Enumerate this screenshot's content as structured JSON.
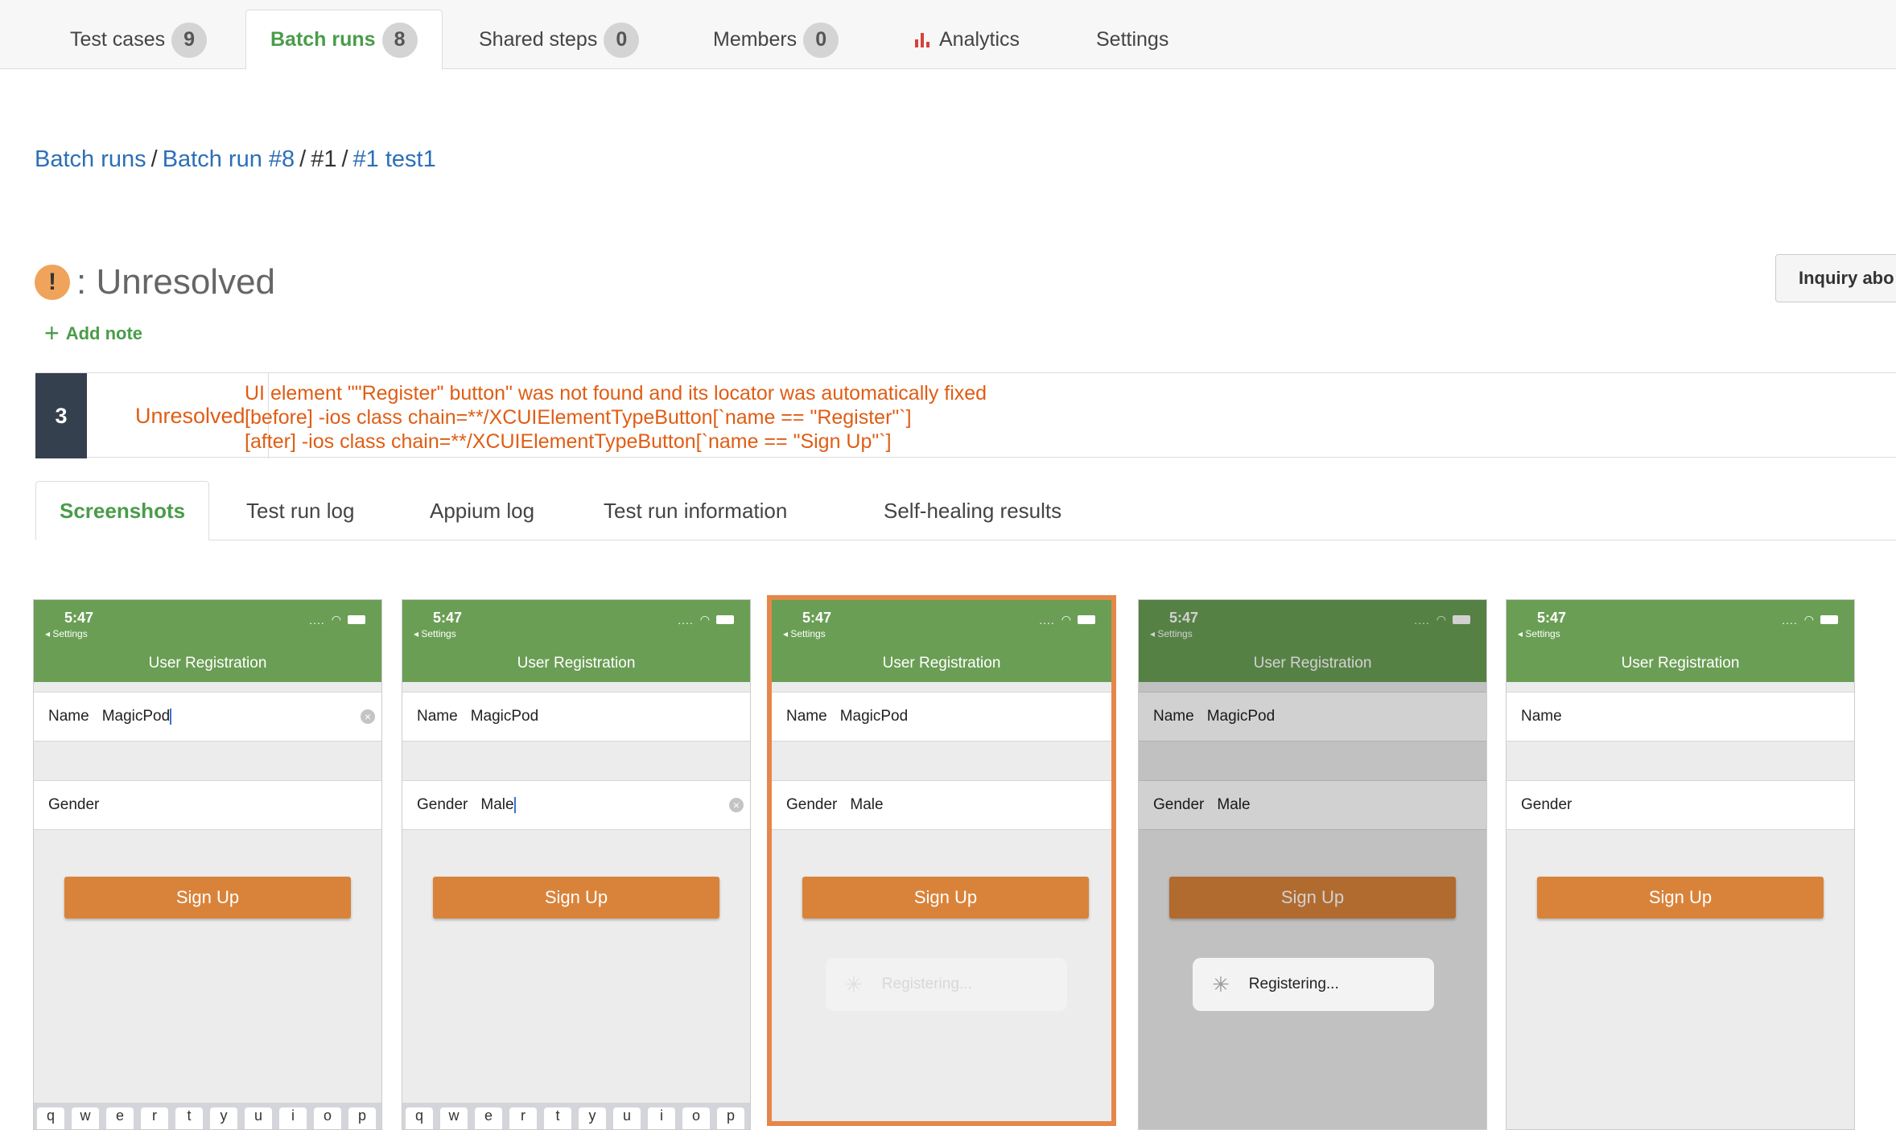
{
  "top_tabs": [
    {
      "label": "Test cases",
      "count": "9"
    },
    {
      "label": "Batch runs",
      "count": "8"
    },
    {
      "label": "Shared steps",
      "count": "0"
    },
    {
      "label": "Members",
      "count": "0"
    },
    {
      "label": "Analytics"
    },
    {
      "label": "Settings"
    }
  ],
  "breadcrumb": {
    "batch_runs": "Batch runs",
    "batch_run": "Batch run #8",
    "run": "#1",
    "test": "#1 test1",
    "separator": "/"
  },
  "status": {
    "icon": "!",
    "text": ": Unresolved",
    "add_note": "Add note",
    "inquiry_button": "Inquiry abo"
  },
  "result": {
    "step": "3",
    "status": "Unresolved",
    "messages": [
      "UI element \"\"Register\" button\" was not found and its locator was automatically fixed",
      "[before] -ios class chain=**/XCUIElementTypeButton[`name == \"Register\"`]",
      "[after] -ios class chain=**/XCUIElementTypeButton[`name == \"Sign Up\"`]"
    ]
  },
  "sub_tabs": [
    "Screenshots",
    "Test run log",
    "Appium log",
    "Test run information",
    "Self-healing results"
  ],
  "phone": {
    "time": "5:47",
    "back": "◂ Settings",
    "title": "User Registration",
    "name_label": "Name",
    "gender_label": "Gender",
    "name_value": "MagicPod",
    "gender_value": "Male",
    "button": "Sign Up",
    "registering": "Registering...",
    "signal": "....",
    "keys": [
      "q",
      "w",
      "e",
      "r",
      "t",
      "y",
      "u",
      "i",
      "o",
      "p"
    ]
  },
  "colors": {
    "accent_green": "#4a9c4a",
    "link_blue": "#2c6fb7",
    "error_orange": "#e05d14",
    "selected_border": "#e5874a",
    "phone_header": "#6a9e55",
    "button_orange": "#d9833a"
  }
}
